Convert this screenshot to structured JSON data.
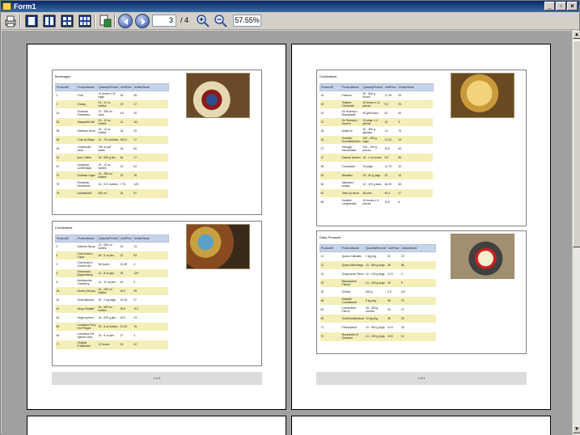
{
  "window": {
    "title": "Form1"
  },
  "toolbar": {
    "page_current": "3",
    "page_count": "/ 4",
    "zoom": "57.55%"
  },
  "columns": [
    "ProductID",
    "ProductName",
    "QuantityPerUnit",
    "UnitPrice",
    "UnitsInStock"
  ],
  "pages": [
    {
      "footer": "1 of 4",
      "panels": [
        {
          "title": "Beverages",
          "rows": [
            [
              "1",
              "Chai",
              "10 boxes x 20 bags",
              "18",
              "39"
            ],
            [
              "2",
              "Chang",
              "24 - 12 oz bottles",
              "19",
              "17"
            ],
            [
              "24",
              "Guaraná Fantástica",
              "12 - 355 ml cans",
              "4.5",
              "20"
            ],
            [
              "34",
              "Sasquatch Ale",
              "24 - 12 oz bottles",
              "14",
              "111"
            ],
            [
              "35",
              "Steeleye Stout",
              "24 - 12 oz bottles",
              "18",
              "20"
            ],
            [
              "38",
              "Côte de Blaye",
              "12 - 75 cl bottles",
              "263.5",
              "17"
            ],
            [
              "39",
              "Chartreuse verte",
              "750 cc per bottle",
              "18",
              "69"
            ],
            [
              "43",
              "Ipoh Coffee",
              "16 - 500 g tins",
              "46",
              "17"
            ],
            [
              "67",
              "Laughing Lumberjack",
              "24 - 12 oz bottles",
              "14",
              "52"
            ],
            [
              "70",
              "Outback Lager",
              "24 - 355 ml bottles",
              "15",
              "15"
            ],
            [
              "75",
              "Rhönbräu Klosterbier",
              "24 - 0.5 l bottles",
              "7.75",
              "125"
            ],
            [
              "76",
              "Lakkalikööri",
              "500 ml",
              "18",
              "57"
            ]
          ]
        },
        {
          "title": "Condiments",
          "rows": [
            [
              "3",
              "Aniseed Syrup",
              "12 - 550 ml bottles",
              "10",
              "13"
            ],
            [
              "4",
              "Chef Anton's Cajun",
              "48 - 6 oz jars",
              "22",
              "53"
            ],
            [
              "5",
              "Chef Anton's Gumbo Mix",
              "36 boxes",
              "21.35",
              "0"
            ],
            [
              "6",
              "Grandma's Boysenberry",
              "12 - 8 oz jars",
              "25",
              "120"
            ],
            [
              "8",
              "Northwoods Cranberry",
              "12 - 12 oz jars",
              "40",
              "6"
            ],
            [
              "15",
              "Genen Shouyu",
              "24 - 250 ml bottles",
              "15.5",
              "39"
            ],
            [
              "44",
              "Gula Malacca",
              "20 - 2 kg bags",
              "19.45",
              "27"
            ],
            [
              "61",
              "Sirop d'érable",
              "24 - 500 ml bottles",
              "28.5",
              "113"
            ],
            [
              "63",
              "Vegie-spread",
              "15 - 625 g jars",
              "43.9",
              "24"
            ],
            [
              "65",
              "Louisiana Fiery Hot Pepper",
              "32 - 8 oz bottles",
              "21.05",
              "76"
            ],
            [
              "66",
              "Louisiana Hot Spiced Okra",
              "24 - 8 oz jars",
              "17",
              "4"
            ],
            [
              "77",
              "Original Frankfurter",
              "12 boxes",
              "13",
              "32"
            ]
          ]
        }
      ]
    },
    {
      "footer": "2 of 4",
      "panels": [
        {
          "title": "Confections",
          "rows": [
            [
              "16",
              "Pavlova",
              "32 - 500 g boxes",
              "17.45",
              "29"
            ],
            [
              "19",
              "Teatime Chocolate",
              "10 boxes x 12 pieces",
              "9.2",
              "25"
            ],
            [
              "20",
              "Sir Rodney's Marmalade",
              "30 gift boxes",
              "81",
              "40"
            ],
            [
              "21",
              "Sir Rodney's Scones",
              "24 pkgs. x 4 pieces",
              "10",
              "3"
            ],
            [
              "25",
              "NuNuCa",
              "20 - 450 g glasses",
              "14",
              "76"
            ],
            [
              "26",
              "Gumbär Gummibärchen",
              "100 - 250 g bags",
              "31.23",
              "15"
            ],
            [
              "27",
              "Schoggi Schokolade",
              "100 - 100 g pieces",
              "43.9",
              "49"
            ],
            [
              "47",
              "Zaanse koeken",
              "10 - 4 oz boxes",
              "9.5",
              "36"
            ],
            [
              "48",
              "Chocolade",
              "10 pkgs.",
              "12.75",
              "15"
            ],
            [
              "49",
              "Maxilaku",
              "24 - 50 g pkgs.",
              "20",
              "10"
            ],
            [
              "50",
              "Valkoinen suklaa",
              "12 - 100 g bars",
              "16.25",
              "65"
            ],
            [
              "62",
              "Tarte au sucre",
              "48 pies",
              "49.3",
              "17"
            ],
            [
              "68",
              "Scottish Longbreads",
              "10 boxes x 8 pieces",
              "12.5",
              "6"
            ]
          ]
        },
        {
          "title": "Dairy Products",
          "rows": [
            [
              "11",
              "Queso Cabrales",
              "1 kg pkg.",
              "21",
              "22"
            ],
            [
              "12",
              "Queso Manchego",
              "10 - 500 g pkgs.",
              "38",
              "86"
            ],
            [
              "31",
              "Gorgonzola Telino",
              "12 - 100 g pkgs",
              "12.5",
              "0"
            ],
            [
              "32",
              "Mascarpone Fabioli",
              "24 - 200 g pkgs.",
              "32",
              "9"
            ],
            [
              "33",
              "Geitost",
              "500 g",
              "2.5",
              "112"
            ],
            [
              "59",
              "Raclette Courdavault",
              "5 kg pkg.",
              "55",
              "79"
            ],
            [
              "60",
              "Camembert Pierrot",
              "15 - 300 g rounds",
              "34",
              "19"
            ],
            [
              "69",
              "Gudbrandsdalsost",
              "10 kg pkg.",
              "36",
              "26"
            ],
            [
              "71",
              "Flotemysost",
              "10 - 500 g pkgs.",
              "21.5",
              "26"
            ],
            [
              "72",
              "Mozzarella di Giovanni",
              "24 - 200 g pkgs.",
              "34.8",
              "14"
            ]
          ]
        }
      ]
    }
  ]
}
